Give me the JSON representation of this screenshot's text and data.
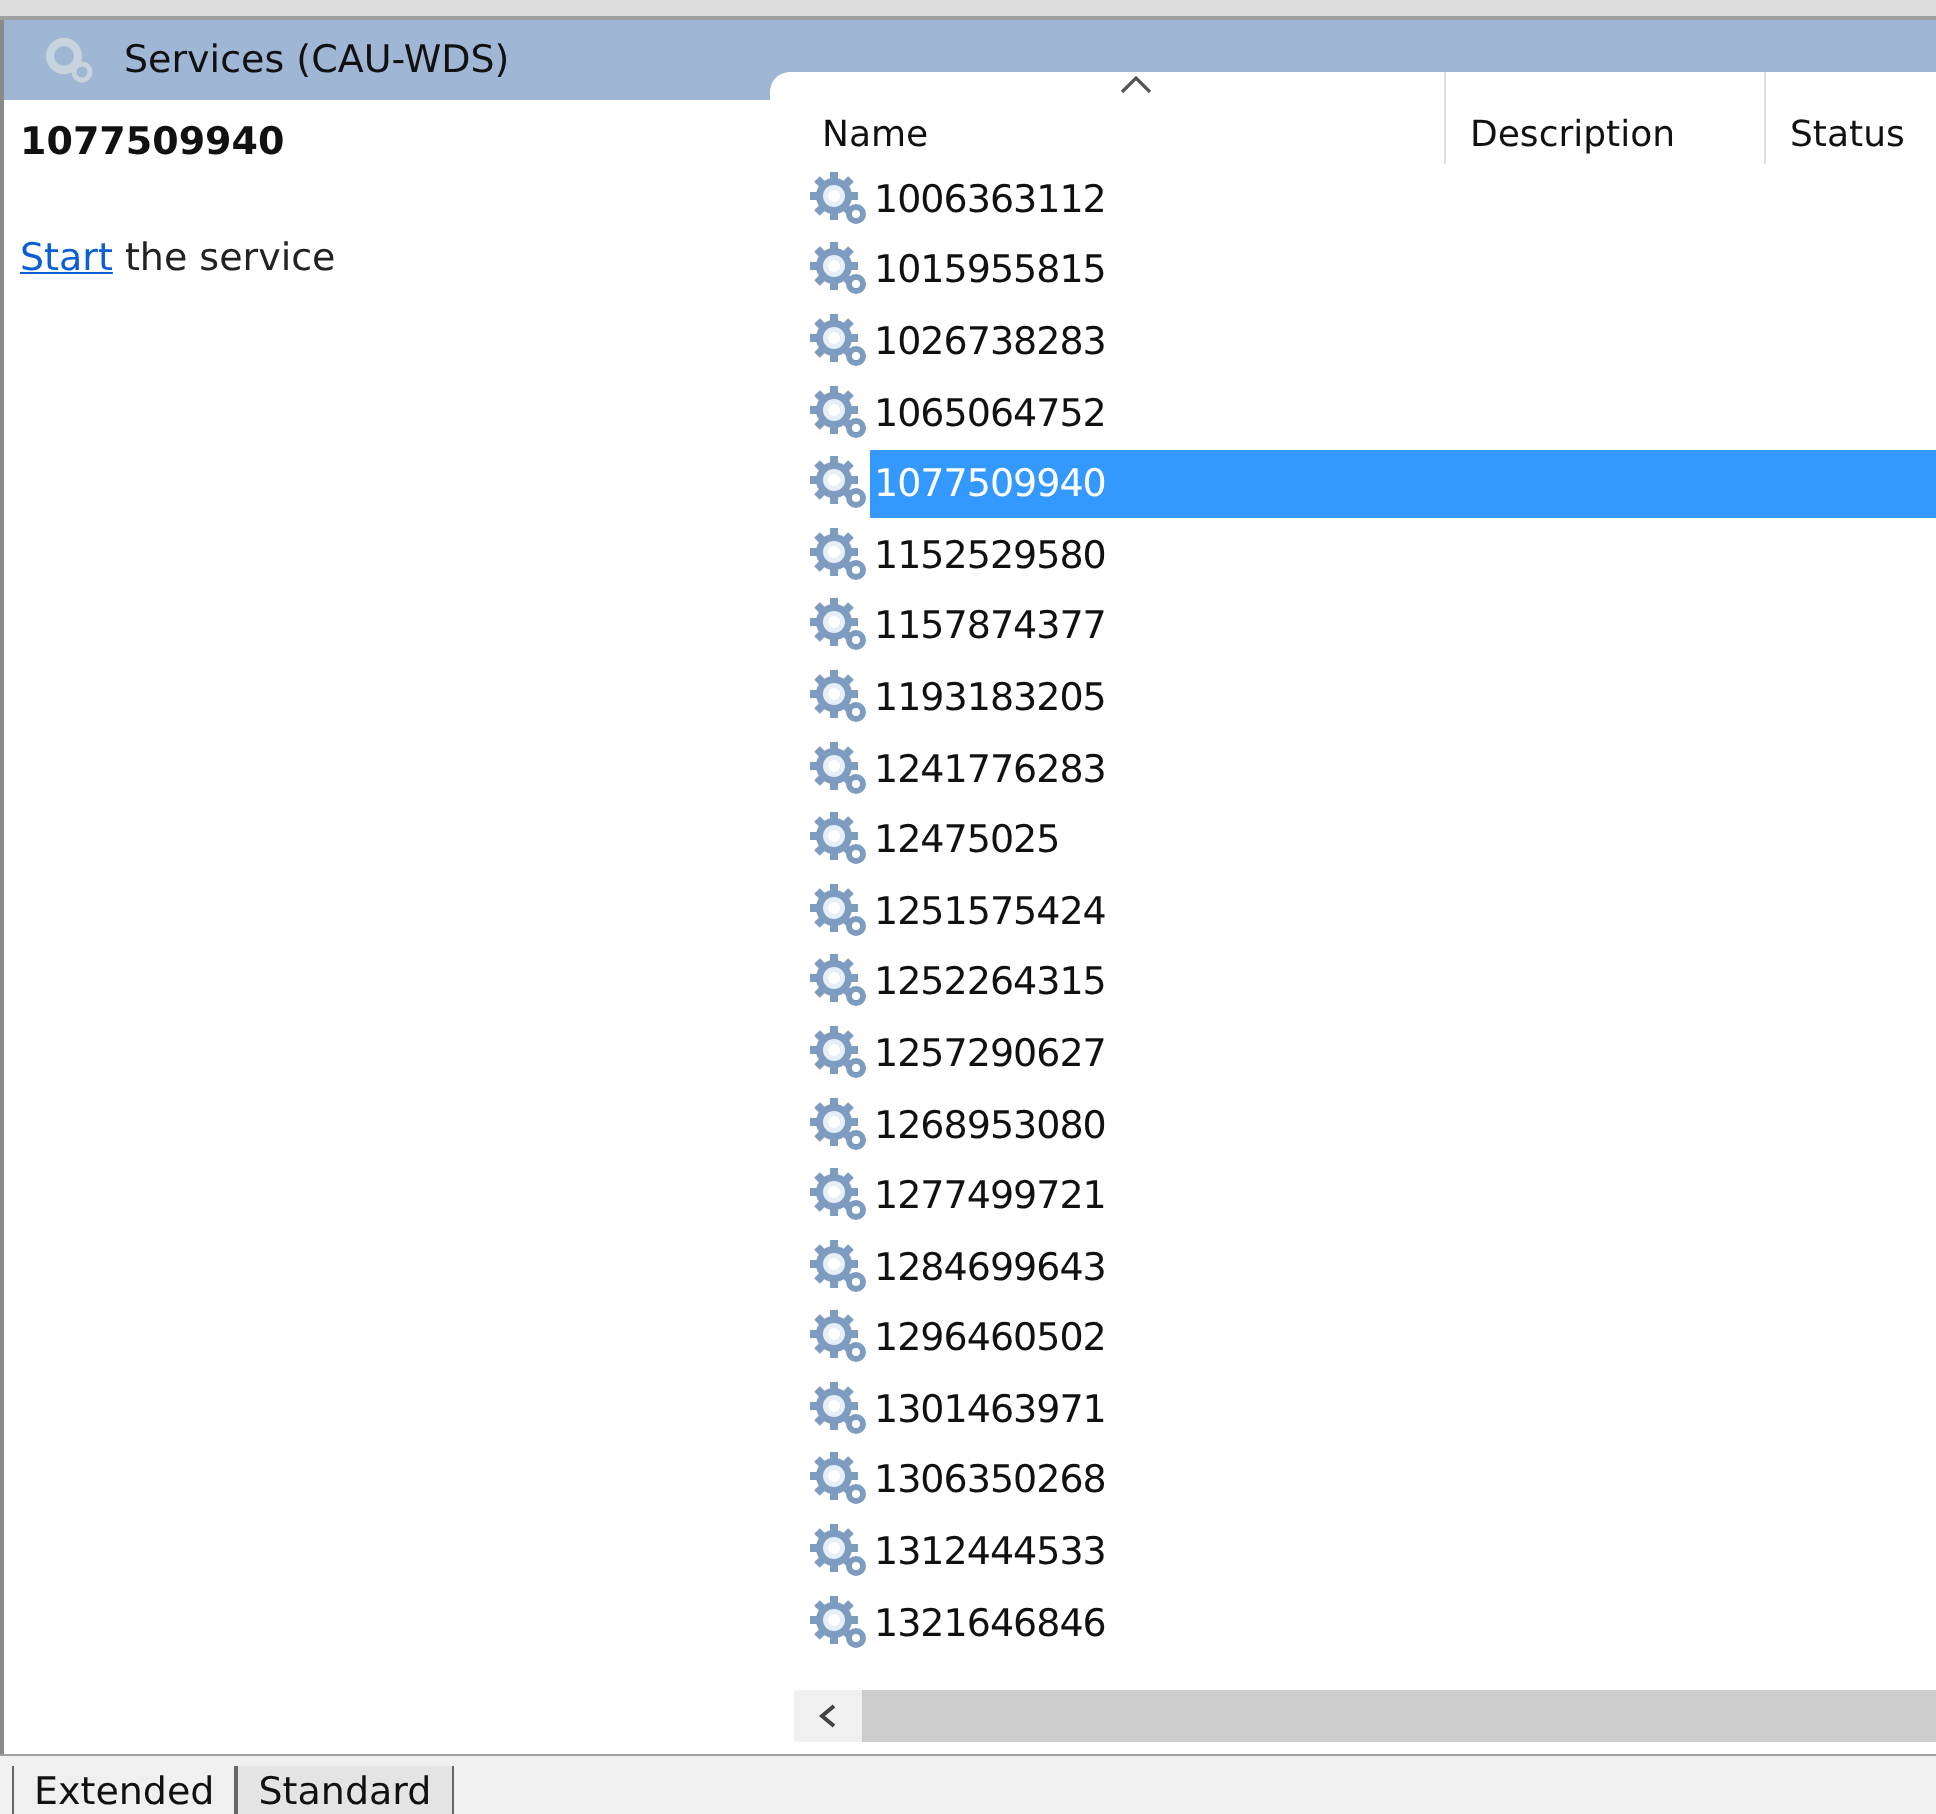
{
  "title_bar": {
    "title": "Services (CAU-WDS)"
  },
  "details": {
    "service_name": "1077509940",
    "action_link": "Start",
    "action_text": " the service"
  },
  "table": {
    "columns": [
      {
        "label": "Name",
        "sorted": true
      },
      {
        "label": "Description",
        "sorted": false
      },
      {
        "label": "Status",
        "sorted": false
      }
    ],
    "rows": [
      {
        "name": "1006363112",
        "selected": false
      },
      {
        "name": "1015955815",
        "selected": false
      },
      {
        "name": "1026738283",
        "selected": false
      },
      {
        "name": "1065064752",
        "selected": false
      },
      {
        "name": "1077509940",
        "selected": true
      },
      {
        "name": "1152529580",
        "selected": false
      },
      {
        "name": "1157874377",
        "selected": false
      },
      {
        "name": "1193183205",
        "selected": false
      },
      {
        "name": "1241776283",
        "selected": false
      },
      {
        "name": "12475025",
        "selected": false
      },
      {
        "name": "1251575424",
        "selected": false
      },
      {
        "name": "1252264315",
        "selected": false
      },
      {
        "name": "1257290627",
        "selected": false
      },
      {
        "name": "1268953080",
        "selected": false
      },
      {
        "name": "1277499721",
        "selected": false
      },
      {
        "name": "1284699643",
        "selected": false
      },
      {
        "name": "1296460502",
        "selected": false
      },
      {
        "name": "1301463971",
        "selected": false
      },
      {
        "name": "1306350268",
        "selected": false
      },
      {
        "name": "1312444533",
        "selected": false
      },
      {
        "name": "1321646846",
        "selected": false
      }
    ]
  },
  "tabs": [
    {
      "label": "Extended",
      "selected": true
    },
    {
      "label": "Standard",
      "selected": false
    }
  ]
}
